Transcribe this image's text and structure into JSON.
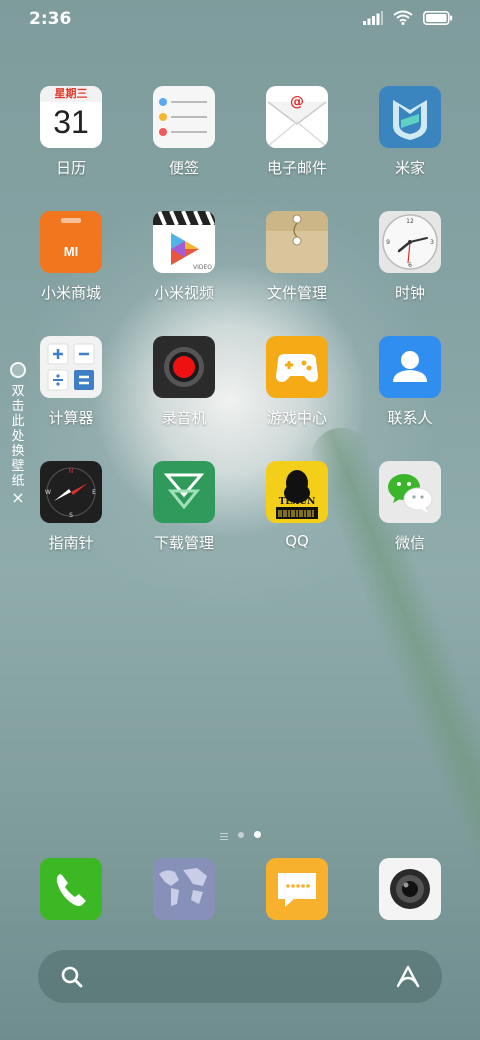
{
  "status_bar": {
    "time": "2:36"
  },
  "side_hint": {
    "chars": [
      "双",
      "击",
      "此",
      "处",
      "换",
      "壁",
      "纸"
    ],
    "close_glyph": "×"
  },
  "calendar": {
    "weekday": "星期三",
    "day": "31"
  },
  "apps_row1": [
    {
      "label": "日历",
      "icon": "calendar-icon"
    },
    {
      "label": "便签",
      "icon": "notes-icon"
    },
    {
      "label": "电子邮件",
      "icon": "email-icon"
    },
    {
      "label": "米家",
      "icon": "mihome-icon"
    }
  ],
  "apps_row2": [
    {
      "label": "小米商城",
      "icon": "mi-store-icon"
    },
    {
      "label": "小米视频",
      "icon": "mi-video-icon"
    },
    {
      "label": "文件管理",
      "icon": "file-manager-icon"
    },
    {
      "label": "时钟",
      "icon": "clock-icon"
    }
  ],
  "apps_row3": [
    {
      "label": "计算器",
      "icon": "calculator-icon"
    },
    {
      "label": "录音机",
      "icon": "recorder-icon"
    },
    {
      "label": "游戏中心",
      "icon": "game-center-icon"
    },
    {
      "label": "联系人",
      "icon": "contacts-icon"
    }
  ],
  "apps_row4": [
    {
      "label": "指南针",
      "icon": "compass-icon"
    },
    {
      "label": "下载管理",
      "icon": "download-manager-icon"
    },
    {
      "label": "QQ",
      "icon": "qq-icon"
    },
    {
      "label": "微信",
      "icon": "wechat-icon"
    }
  ],
  "icon_text": {
    "mi_store": "MI",
    "video_badge": "VIDEO",
    "qq_texun": "TEXUN",
    "clock_numbers": [
      "12",
      "3",
      "6",
      "9"
    ],
    "compass_letters": [
      "N",
      "E",
      "S",
      "W"
    ]
  },
  "dock": [
    {
      "icon": "phone-icon"
    },
    {
      "icon": "browser-icon"
    },
    {
      "icon": "messages-icon"
    },
    {
      "icon": "camera-icon"
    }
  ],
  "colors": {
    "phone": "#3cb824",
    "mi_store": "#f2761d",
    "game": "#f5ab16",
    "contacts": "#2f8ef0",
    "messages": "#f7b12c"
  }
}
